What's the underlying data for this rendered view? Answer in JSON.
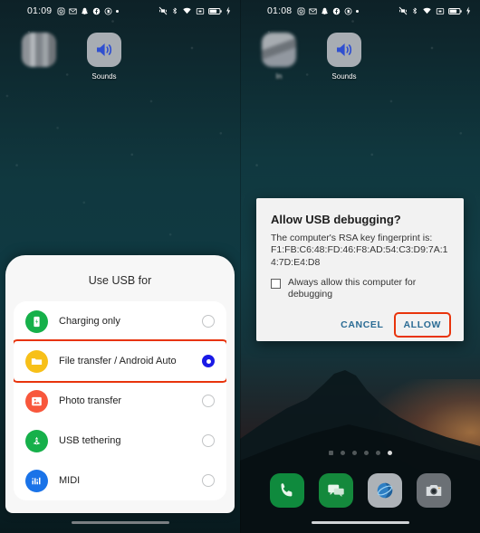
{
  "left_phone": {
    "statusbar": {
      "time": "01:09",
      "left_icons": [
        "instagram-icon",
        "gmail-icon",
        "snapchat-icon",
        "facebook-icon",
        "badge-icon",
        "dot-icon"
      ],
      "right_icons": [
        "vibrate-off-icon",
        "bluetooth-icon",
        "wifi-icon",
        "no-sim-icon",
        "battery-icon",
        "charging-bolt-icon"
      ]
    },
    "apps": [
      {
        "label": "",
        "icon": "blurred-app-icon",
        "blurred": true
      },
      {
        "label": "Sounds",
        "icon": "sounds-icon",
        "blurred": false
      }
    ],
    "usb_sheet": {
      "title": "Use USB for",
      "options": [
        {
          "label": "Charging only",
          "icon": "battery-charging-icon",
          "icon_color": "#16b04a",
          "selected": false
        },
        {
          "label": "File transfer / Android Auto",
          "icon": "folder-icon",
          "icon_color": "#f7c019",
          "selected": true
        },
        {
          "label": "Photo transfer",
          "icon": "photo-icon",
          "icon_color": "#f8573c",
          "selected": false
        },
        {
          "label": "USB tethering",
          "icon": "tethering-icon",
          "icon_color": "#16b04a",
          "selected": false
        },
        {
          "label": "MIDI",
          "icon": "midi-icon",
          "icon_color": "#1a73e8",
          "selected": false
        }
      ],
      "highlight_color": "#e8340c",
      "radio_selected_color": "#1a1ae6"
    }
  },
  "right_phone": {
    "statusbar": {
      "time": "01:08",
      "left_icons": [
        "instagram-icon",
        "gmail-icon",
        "snapchat-icon",
        "facebook-icon",
        "badge-icon",
        "dot-icon"
      ],
      "right_icons": [
        "vibrate-off-icon",
        "bluetooth-icon",
        "wifi-icon",
        "no-sim-icon",
        "battery-icon",
        "charging-bolt-icon"
      ]
    },
    "apps": [
      {
        "label": "In",
        "icon": "blurred-app-icon",
        "blurred": true
      },
      {
        "label": "Sounds",
        "icon": "sounds-icon",
        "blurred": false
      }
    ],
    "adb_dialog": {
      "title": "Allow USB debugging?",
      "body_line1": "The computer's RSA key fingerprint is:",
      "fingerprint": "F1:FB:C6:48:FD:46:F8:AD:54:C3:D9:7A:14:7D:E4:D8",
      "checkbox_label": "Always allow this computer for debugging",
      "checkbox_checked": false,
      "cancel_label": "CANCEL",
      "allow_label": "ALLOW",
      "allow_highlighted": true,
      "button_color": "#2a6b94",
      "highlight_color": "#e8340c"
    },
    "page_dots": {
      "count": 6,
      "active_index": 5
    },
    "dock": [
      {
        "label": "Phone",
        "icon": "phone-icon",
        "color": "#0f8a3d"
      },
      {
        "label": "Messages",
        "icon": "messages-icon",
        "color": "#14893c"
      },
      {
        "label": "Browser",
        "icon": "browser-icon",
        "color": "#adb2b7"
      },
      {
        "label": "Camera",
        "icon": "camera-icon",
        "color": "#6b7075"
      }
    ]
  }
}
